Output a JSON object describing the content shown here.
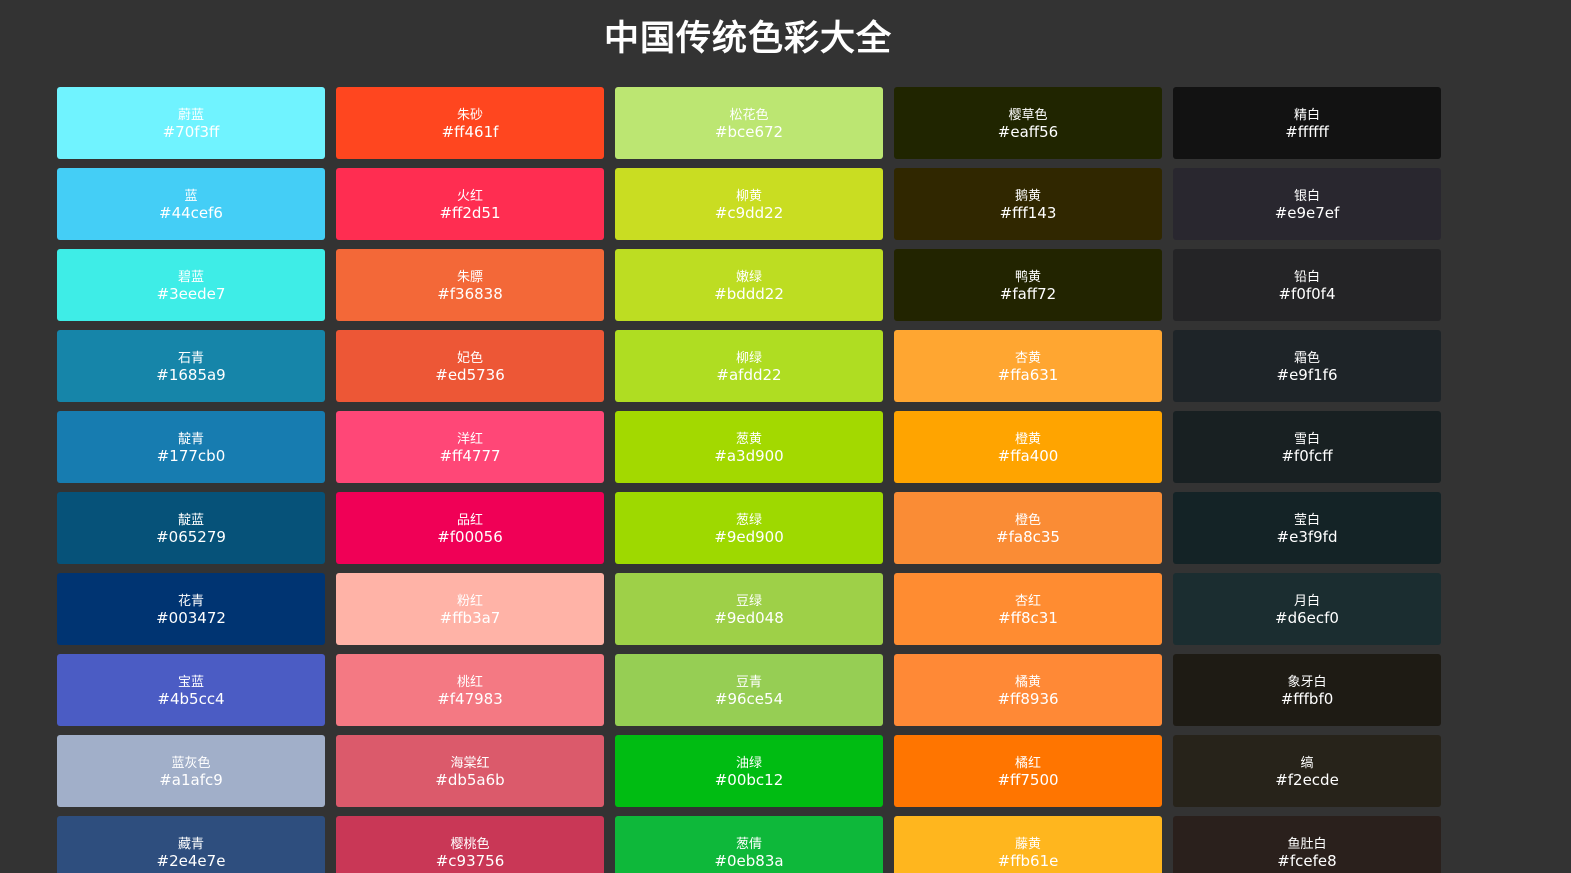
{
  "page": {
    "title": "中国传统色彩大全"
  },
  "columns": [
    {
      "items": [
        {
          "name": "蔚蓝",
          "hex": "#70f3ff",
          "bg": "#70f3ff"
        },
        {
          "name": "蓝",
          "hex": "#44cef6",
          "bg": "#44cef6"
        },
        {
          "name": "碧蓝",
          "hex": "#3eede7",
          "bg": "#3eede7"
        },
        {
          "name": "石青",
          "hex": "#1685a9",
          "bg": "#1685a9"
        },
        {
          "name": "靛青",
          "hex": "#177cb0",
          "bg": "#177cb0"
        },
        {
          "name": "靛蓝",
          "hex": "#065279",
          "bg": "#065279"
        },
        {
          "name": "花青",
          "hex": "#003472",
          "bg": "#003472"
        },
        {
          "name": "宝蓝",
          "hex": "#4b5cc4",
          "bg": "#4b5cc4"
        },
        {
          "name": "蓝灰色",
          "hex": "#a1afc9",
          "bg": "#a1afc9"
        },
        {
          "name": "藏青",
          "hex": "#2e4e7e",
          "bg": "#2e4e7e"
        }
      ]
    },
    {
      "items": [
        {
          "name": "朱砂",
          "hex": "#ff461f",
          "bg": "#ff461f"
        },
        {
          "name": "火红",
          "hex": "#ff2d51",
          "bg": "#ff2d51"
        },
        {
          "name": "朱膘",
          "hex": "#f36838",
          "bg": "#f36838"
        },
        {
          "name": "妃色",
          "hex": "#ed5736",
          "bg": "#ed5736"
        },
        {
          "name": "洋红",
          "hex": "#ff4777",
          "bg": "#ff4777"
        },
        {
          "name": "品红",
          "hex": "#f00056",
          "bg": "#f00056"
        },
        {
          "name": "粉红",
          "hex": "#ffb3a7",
          "bg": "#ffb3a7"
        },
        {
          "name": "桃红",
          "hex": "#f47983",
          "bg": "#f47983"
        },
        {
          "name": "海棠红",
          "hex": "#db5a6b",
          "bg": "#db5a6b"
        },
        {
          "name": "樱桃色",
          "hex": "#c93756",
          "bg": "#c93756"
        }
      ]
    },
    {
      "items": [
        {
          "name": "松花色",
          "hex": "#bce672",
          "bg": "#bce672"
        },
        {
          "name": "柳黄",
          "hex": "#c9dd22",
          "bg": "#c9dd22"
        },
        {
          "name": "嫩绿",
          "hex": "#bddd22",
          "bg": "#bddd22"
        },
        {
          "name": "柳绿",
          "hex": "#afdd22",
          "bg": "#afdd22"
        },
        {
          "name": "葱黄",
          "hex": "#a3d900",
          "bg": "#a3d900"
        },
        {
          "name": "葱绿",
          "hex": "#9ed900",
          "bg": "#9ed900"
        },
        {
          "name": "豆绿",
          "hex": "#9ed048",
          "bg": "#9ed048"
        },
        {
          "name": "豆青",
          "hex": "#96ce54",
          "bg": "#96ce54"
        },
        {
          "name": "油绿",
          "hex": "#00bc12",
          "bg": "#00bc12"
        },
        {
          "name": "葱倩",
          "hex": "#0eb83a",
          "bg": "#0eb83a"
        }
      ]
    },
    {
      "items": [
        {
          "name": "樱草色",
          "hex": "#eaff56",
          "bg": "#202500"
        },
        {
          "name": "鹅黄",
          "hex": "#fff143",
          "bg": "#302700"
        },
        {
          "name": "鸭黄",
          "hex": "#faff72",
          "bg": "#222400"
        },
        {
          "name": "杏黄",
          "hex": "#ffa631",
          "bg": "#ffa631"
        },
        {
          "name": "橙黄",
          "hex": "#ffa400",
          "bg": "#ffa400"
        },
        {
          "name": "橙色",
          "hex": "#fa8c35",
          "bg": "#fa8c35"
        },
        {
          "name": "杏红",
          "hex": "#ff8c31",
          "bg": "#ff8c31"
        },
        {
          "name": "橘黄",
          "hex": "#ff8936",
          "bg": "#ff8936"
        },
        {
          "name": "橘红",
          "hex": "#ff7500",
          "bg": "#ff7500"
        },
        {
          "name": "藤黄",
          "hex": "#ffb61e",
          "bg": "#ffb61e"
        }
      ]
    },
    {
      "items": [
        {
          "name": "精白",
          "hex": "#ffffff",
          "bg": "#121212"
        },
        {
          "name": "银白",
          "hex": "#e9e7ef",
          "bg": "#29272f"
        },
        {
          "name": "铅白",
          "hex": "#f0f0f4",
          "bg": "#242426"
        },
        {
          "name": "霜色",
          "hex": "#e9f1f6",
          "bg": "#1e2428"
        },
        {
          "name": "雪白",
          "hex": "#f0fcff",
          "bg": "#182022"
        },
        {
          "name": "莹白",
          "hex": "#e3f9fd",
          "bg": "#142326"
        },
        {
          "name": "月白",
          "hex": "#d6ecf0",
          "bg": "#1b2d30"
        },
        {
          "name": "象牙白",
          "hex": "#fffbf0",
          "bg": "#1e1b14"
        },
        {
          "name": "缟",
          "hex": "#f2ecde",
          "bg": "#27231a"
        },
        {
          "name": "鱼肚白",
          "hex": "#fcefe8",
          "bg": "#2a201c"
        }
      ]
    }
  ]
}
